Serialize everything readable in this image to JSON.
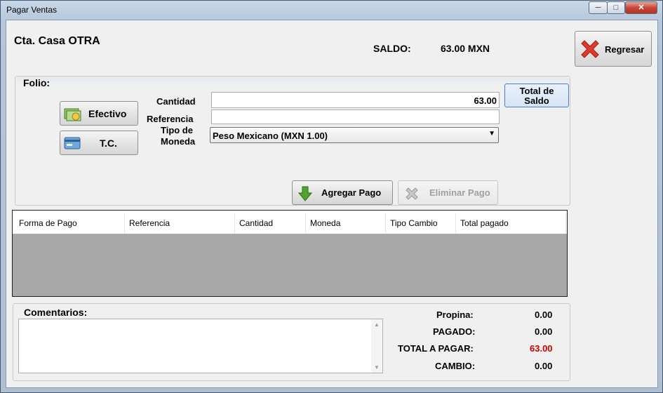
{
  "window": {
    "title": "Pagar Ventas"
  },
  "header": {
    "account_name": "Cta. Casa OTRA",
    "saldo_label": "SALDO:",
    "saldo_value": "63.00 MXN",
    "back_button": "Regresar"
  },
  "folio": {
    "label": "Folio:",
    "cash_button": "Efectivo",
    "card_button": "T.C.",
    "cantidad_label": "Cantidad",
    "cantidad_value": "63.00",
    "referencia_label": "Referencia",
    "referencia_value": "",
    "moneda_label_1": "Tipo de",
    "moneda_label_2": "Moneda",
    "moneda_selected": "Peso Mexicano (MXN 1.00)",
    "total_saldo_1": "Total de",
    "total_saldo_2": "Saldo",
    "add_button": "Agregar Pago",
    "remove_button": "Eliminar Pago"
  },
  "payments_table": {
    "columns": [
      "Forma de Pago",
      "Referencia",
      "Cantidad",
      "Moneda",
      "Tipo Cambio",
      "Total pagado"
    ],
    "rows": []
  },
  "comments": {
    "label": "Comentarios:",
    "value": ""
  },
  "summary": {
    "propina_label": "Propina:",
    "propina_value": "0.00",
    "pagado_label": "PAGADO:",
    "pagado_value": "0.00",
    "total_label": "TOTAL A PAGAR:",
    "total_value": "63.00",
    "cambio_label": "CAMBIO:",
    "cambio_value": "0.00"
  },
  "colors": {
    "total_value": "#cc0000",
    "grid_body": "#a8a8a8",
    "selected_button": "#dde8f6"
  }
}
